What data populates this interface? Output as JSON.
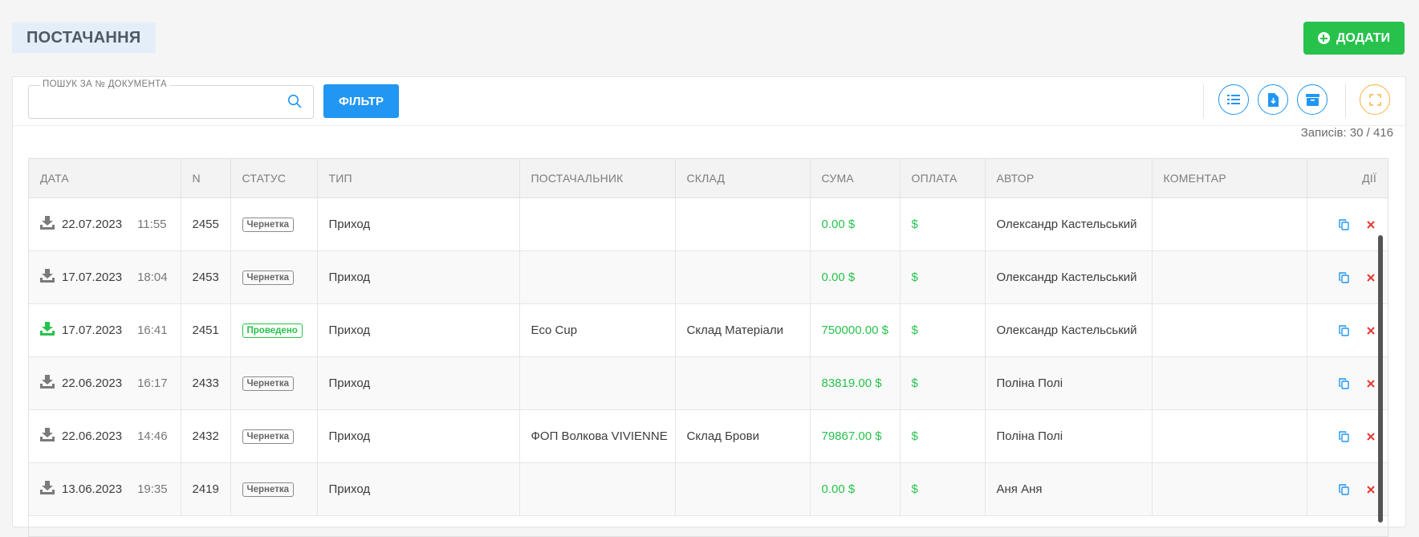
{
  "header": {
    "title": "ПОСТАЧАННЯ",
    "add_label": "ДОДАТИ"
  },
  "colors": {
    "accent": "#2196f3",
    "success": "#27c24c",
    "warning": "#f5b342",
    "danger": "#e53935"
  },
  "toolbar": {
    "search_label": "ПОШУК ЗА № ДОКУМЕНТА",
    "search_value": "",
    "filter_label": "ФІЛЬТР",
    "icons": [
      "columns-icon",
      "download-doc-icon",
      "archive-icon",
      "fullscreen-icon"
    ],
    "records": "Записів: 30 / 416"
  },
  "table": {
    "headers": [
      "ДАТА",
      "N",
      "СТАТУС",
      "ТИП",
      "ПОСТАЧАЛЬНИК",
      "СКЛАД",
      "СУМА",
      "ОПЛАТА",
      "АВТОР",
      "КОМЕНТАР",
      "ДІЇ"
    ],
    "rows": [
      {
        "date": "22.07.2023",
        "time": "11:55",
        "n": "2455",
        "status": "Чернетка",
        "status_done": false,
        "type": "Приход",
        "supplier": "",
        "warehouse": "",
        "sum": "0.00 $",
        "payment": "$",
        "author": "Олександр Кастельський",
        "comment": ""
      },
      {
        "date": "17.07.2023",
        "time": "18:04",
        "n": "2453",
        "status": "Чернетка",
        "status_done": false,
        "type": "Приход",
        "supplier": "",
        "warehouse": "",
        "sum": "0.00 $",
        "payment": "$",
        "author": "Олександр Кастельський",
        "comment": ""
      },
      {
        "date": "17.07.2023",
        "time": "16:41",
        "n": "2451",
        "status": "Проведено",
        "status_done": true,
        "type": "Приход",
        "supplier": "Eco Cup",
        "warehouse": "Склад Матеріали",
        "sum": "750000.00 $",
        "payment": "$",
        "author": "Олександр Кастельський",
        "comment": ""
      },
      {
        "date": "22.06.2023",
        "time": "16:17",
        "n": "2433",
        "status": "Чернетка",
        "status_done": false,
        "type": "Приход",
        "supplier": "",
        "warehouse": "",
        "sum": "83819.00 $",
        "payment": "$",
        "author": "Поліна Полі",
        "comment": ""
      },
      {
        "date": "22.06.2023",
        "time": "14:46",
        "n": "2432",
        "status": "Чернетка",
        "status_done": false,
        "type": "Приход",
        "supplier": "ФОП Волкова VIVIENNE",
        "warehouse": "Склад Брови",
        "sum": "79867.00 $",
        "payment": "$",
        "author": "Поліна Полі",
        "comment": ""
      },
      {
        "date": "13.06.2023",
        "time": "19:35",
        "n": "2419",
        "status": "Чернетка",
        "status_done": false,
        "type": "Приход",
        "supplier": "",
        "warehouse": "",
        "sum": "0.00 $",
        "payment": "$",
        "author": "Аня Аня",
        "comment": ""
      }
    ]
  }
}
